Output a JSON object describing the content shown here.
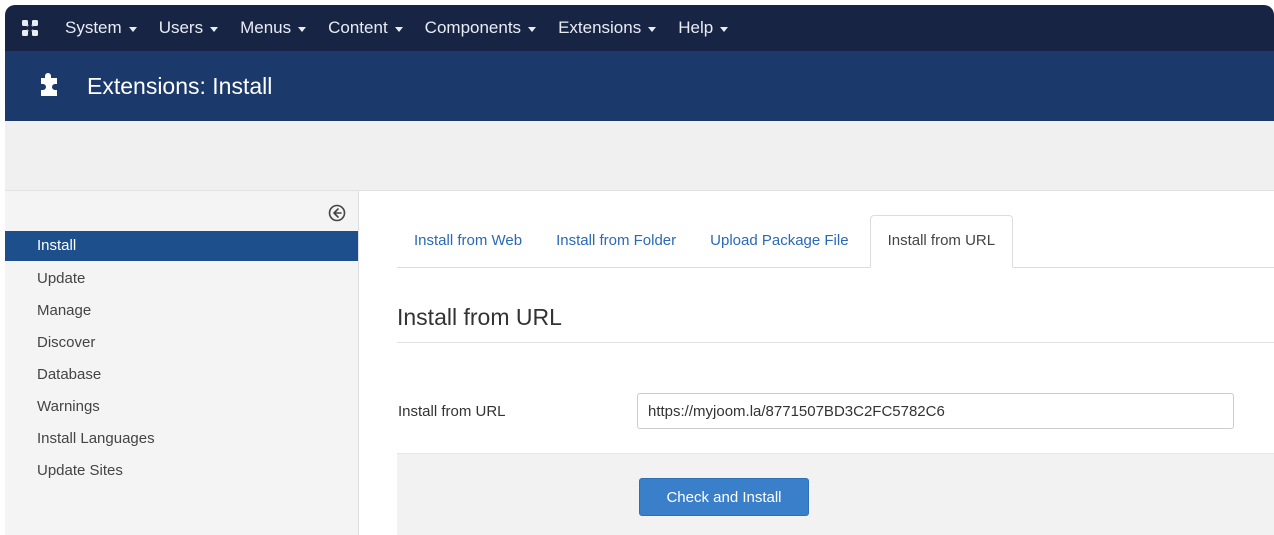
{
  "topnav": {
    "logo_icon": "joomla-logo-icon",
    "items": [
      {
        "label": "System"
      },
      {
        "label": "Users"
      },
      {
        "label": "Menus"
      },
      {
        "label": "Content"
      },
      {
        "label": "Components"
      },
      {
        "label": "Extensions"
      },
      {
        "label": "Help"
      }
    ]
  },
  "titlebar": {
    "icon": "puzzle-piece-icon",
    "title": "Extensions: Install"
  },
  "sidebar": {
    "toggle_icon": "circle-arrow-left-icon",
    "items": [
      {
        "label": "Install",
        "active": true
      },
      {
        "label": "Update"
      },
      {
        "label": "Manage"
      },
      {
        "label": "Discover"
      },
      {
        "label": "Database"
      },
      {
        "label": "Warnings"
      },
      {
        "label": "Install Languages"
      },
      {
        "label": "Update Sites"
      }
    ]
  },
  "main": {
    "tabs": [
      {
        "label": "Install from Web"
      },
      {
        "label": "Install from Folder"
      },
      {
        "label": "Upload Package File"
      },
      {
        "label": "Install from URL",
        "active": true
      }
    ],
    "section_title": "Install from URL",
    "url_field": {
      "label": "Install from URL",
      "value": "https://myjoom.la/8771507BD3C2FC5782C6"
    },
    "submit_label": "Check and Install"
  },
  "colors": {
    "topnav_bg": "#172444",
    "titlebar_bg": "#1b3a6b",
    "sidebar_active_bg": "#1c4f8c",
    "link": "#2a69b8",
    "button_primary": "#3a7fc9"
  }
}
